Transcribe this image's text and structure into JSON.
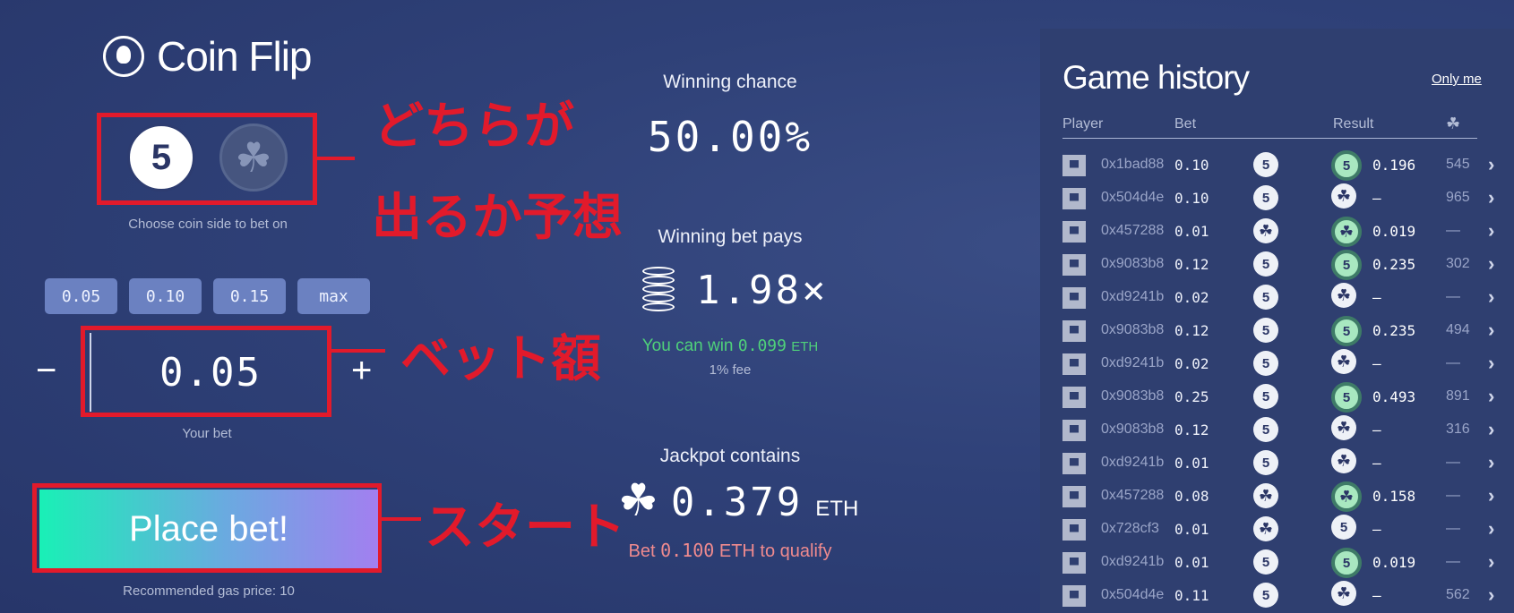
{
  "title": "Coin Flip",
  "coin_sides": {
    "five": "5",
    "clover": "☘",
    "choose_label": "Choose coin side to bet on"
  },
  "presets": [
    "0.05",
    "0.10",
    "0.15",
    "max"
  ],
  "bet": {
    "value": "0.05",
    "minus": "−",
    "plus": "+",
    "label": "Your bet"
  },
  "place_bet": {
    "label": "Place bet!",
    "gas": "Recommended gas price: 10"
  },
  "stats": {
    "winning_chance_label": "Winning chance",
    "winning_chance": "50.00%",
    "winning_pays_label": "Winning bet pays",
    "winning_pays": "1.98×",
    "can_win_prefix": "You can win",
    "can_win_value": "0.099",
    "can_win_unit": "ETH",
    "fee": "1% fee",
    "jackpot_label": "Jackpot contains",
    "jackpot_value": "0.379",
    "jackpot_unit": "ETH",
    "qualify_prefix": "Bet",
    "qualify_value": "0.100",
    "qualify_suffix": "ETH to qualify"
  },
  "annotations": {
    "coin": "どちらが",
    "coin_2": "出るか予想",
    "bet": "ベット額",
    "start": "スタート"
  },
  "history": {
    "title": "Game history",
    "only_me": "Only me",
    "headers": {
      "player": "Player",
      "bet": "Bet",
      "result": "Result",
      "jackpot": "☘"
    },
    "rows": [
      {
        "player": "0x1bad88",
        "bet": "0.10",
        "pick": "5",
        "result": "5",
        "win": true,
        "payout": "0.196",
        "jack": "545"
      },
      {
        "player": "0x504d4e",
        "bet": "0.10",
        "pick": "5",
        "result": "☘",
        "win": false,
        "payout": "—",
        "jack": "965"
      },
      {
        "player": "0x457288",
        "bet": "0.01",
        "pick": "☘",
        "result": "☘",
        "win": true,
        "payout": "0.019",
        "jack": "—"
      },
      {
        "player": "0x9083b8",
        "bet": "0.12",
        "pick": "5",
        "result": "5",
        "win": true,
        "payout": "0.235",
        "jack": "302"
      },
      {
        "player": "0xd9241b",
        "bet": "0.02",
        "pick": "5",
        "result": "☘",
        "win": false,
        "payout": "—",
        "jack": "—"
      },
      {
        "player": "0x9083b8",
        "bet": "0.12",
        "pick": "5",
        "result": "5",
        "win": true,
        "payout": "0.235",
        "jack": "494"
      },
      {
        "player": "0xd9241b",
        "bet": "0.02",
        "pick": "5",
        "result": "☘",
        "win": false,
        "payout": "—",
        "jack": "—"
      },
      {
        "player": "0x9083b8",
        "bet": "0.25",
        "pick": "5",
        "result": "5",
        "win": true,
        "payout": "0.493",
        "jack": "891"
      },
      {
        "player": "0x9083b8",
        "bet": "0.12",
        "pick": "5",
        "result": "☘",
        "win": false,
        "payout": "—",
        "jack": "316"
      },
      {
        "player": "0xd9241b",
        "bet": "0.01",
        "pick": "5",
        "result": "☘",
        "win": false,
        "payout": "—",
        "jack": "—"
      },
      {
        "player": "0x457288",
        "bet": "0.08",
        "pick": "☘",
        "result": "☘",
        "win": true,
        "payout": "0.158",
        "jack": "—"
      },
      {
        "player": "0x728cf3",
        "bet": "0.01",
        "pick": "☘",
        "result": "5",
        "win": false,
        "payout": "—",
        "jack": "—"
      },
      {
        "player": "0xd9241b",
        "bet": "0.01",
        "pick": "5",
        "result": "5",
        "win": true,
        "payout": "0.019",
        "jack": "—"
      },
      {
        "player": "0x504d4e",
        "bet": "0.11",
        "pick": "5",
        "result": "☘",
        "win": false,
        "payout": "—",
        "jack": "562"
      }
    ]
  }
}
